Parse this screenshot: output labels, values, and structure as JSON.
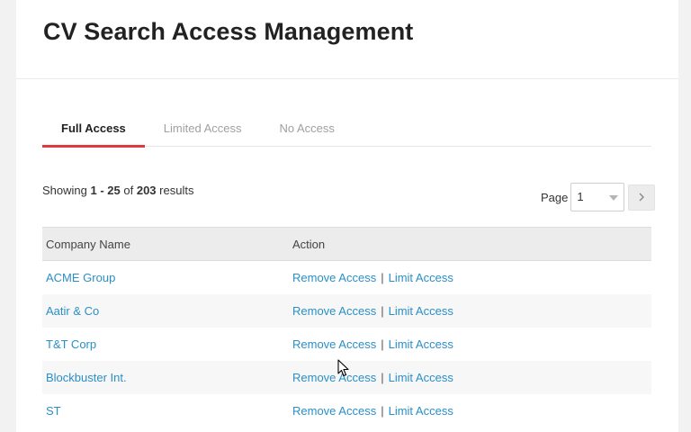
{
  "header": {
    "title": "CV Search Access Management"
  },
  "tabs": [
    {
      "label": "Full Access",
      "active": true
    },
    {
      "label": "Limited Access",
      "active": false
    },
    {
      "label": "No Access",
      "active": false
    }
  ],
  "results": {
    "prefix": "Showing",
    "range": "1 - 25",
    "of": "of",
    "total": "203",
    "suffix": "results"
  },
  "pager": {
    "label": "Page",
    "current": "1",
    "next_icon": "chevron-right-icon"
  },
  "table": {
    "columns": [
      "Company Name",
      "Action"
    ],
    "rows": [
      {
        "company": "ACME Group",
        "remove": "Remove Access",
        "limit": "Limit Access"
      },
      {
        "company": "Aatir & Co",
        "remove": "Remove Access",
        "limit": "Limit Access"
      },
      {
        "company": "T&T Corp",
        "remove": "Remove Access",
        "limit": "Limit Access"
      },
      {
        "company": "Blockbuster Int.",
        "remove": "Remove Access",
        "limit": "Limit Access"
      },
      {
        "company": "ST",
        "remove": "Remove Access",
        "limit": "Limit Access"
      }
    ],
    "separator": "|"
  },
  "colors": {
    "accent": "#e0393e",
    "link": "#2a8fc7"
  }
}
